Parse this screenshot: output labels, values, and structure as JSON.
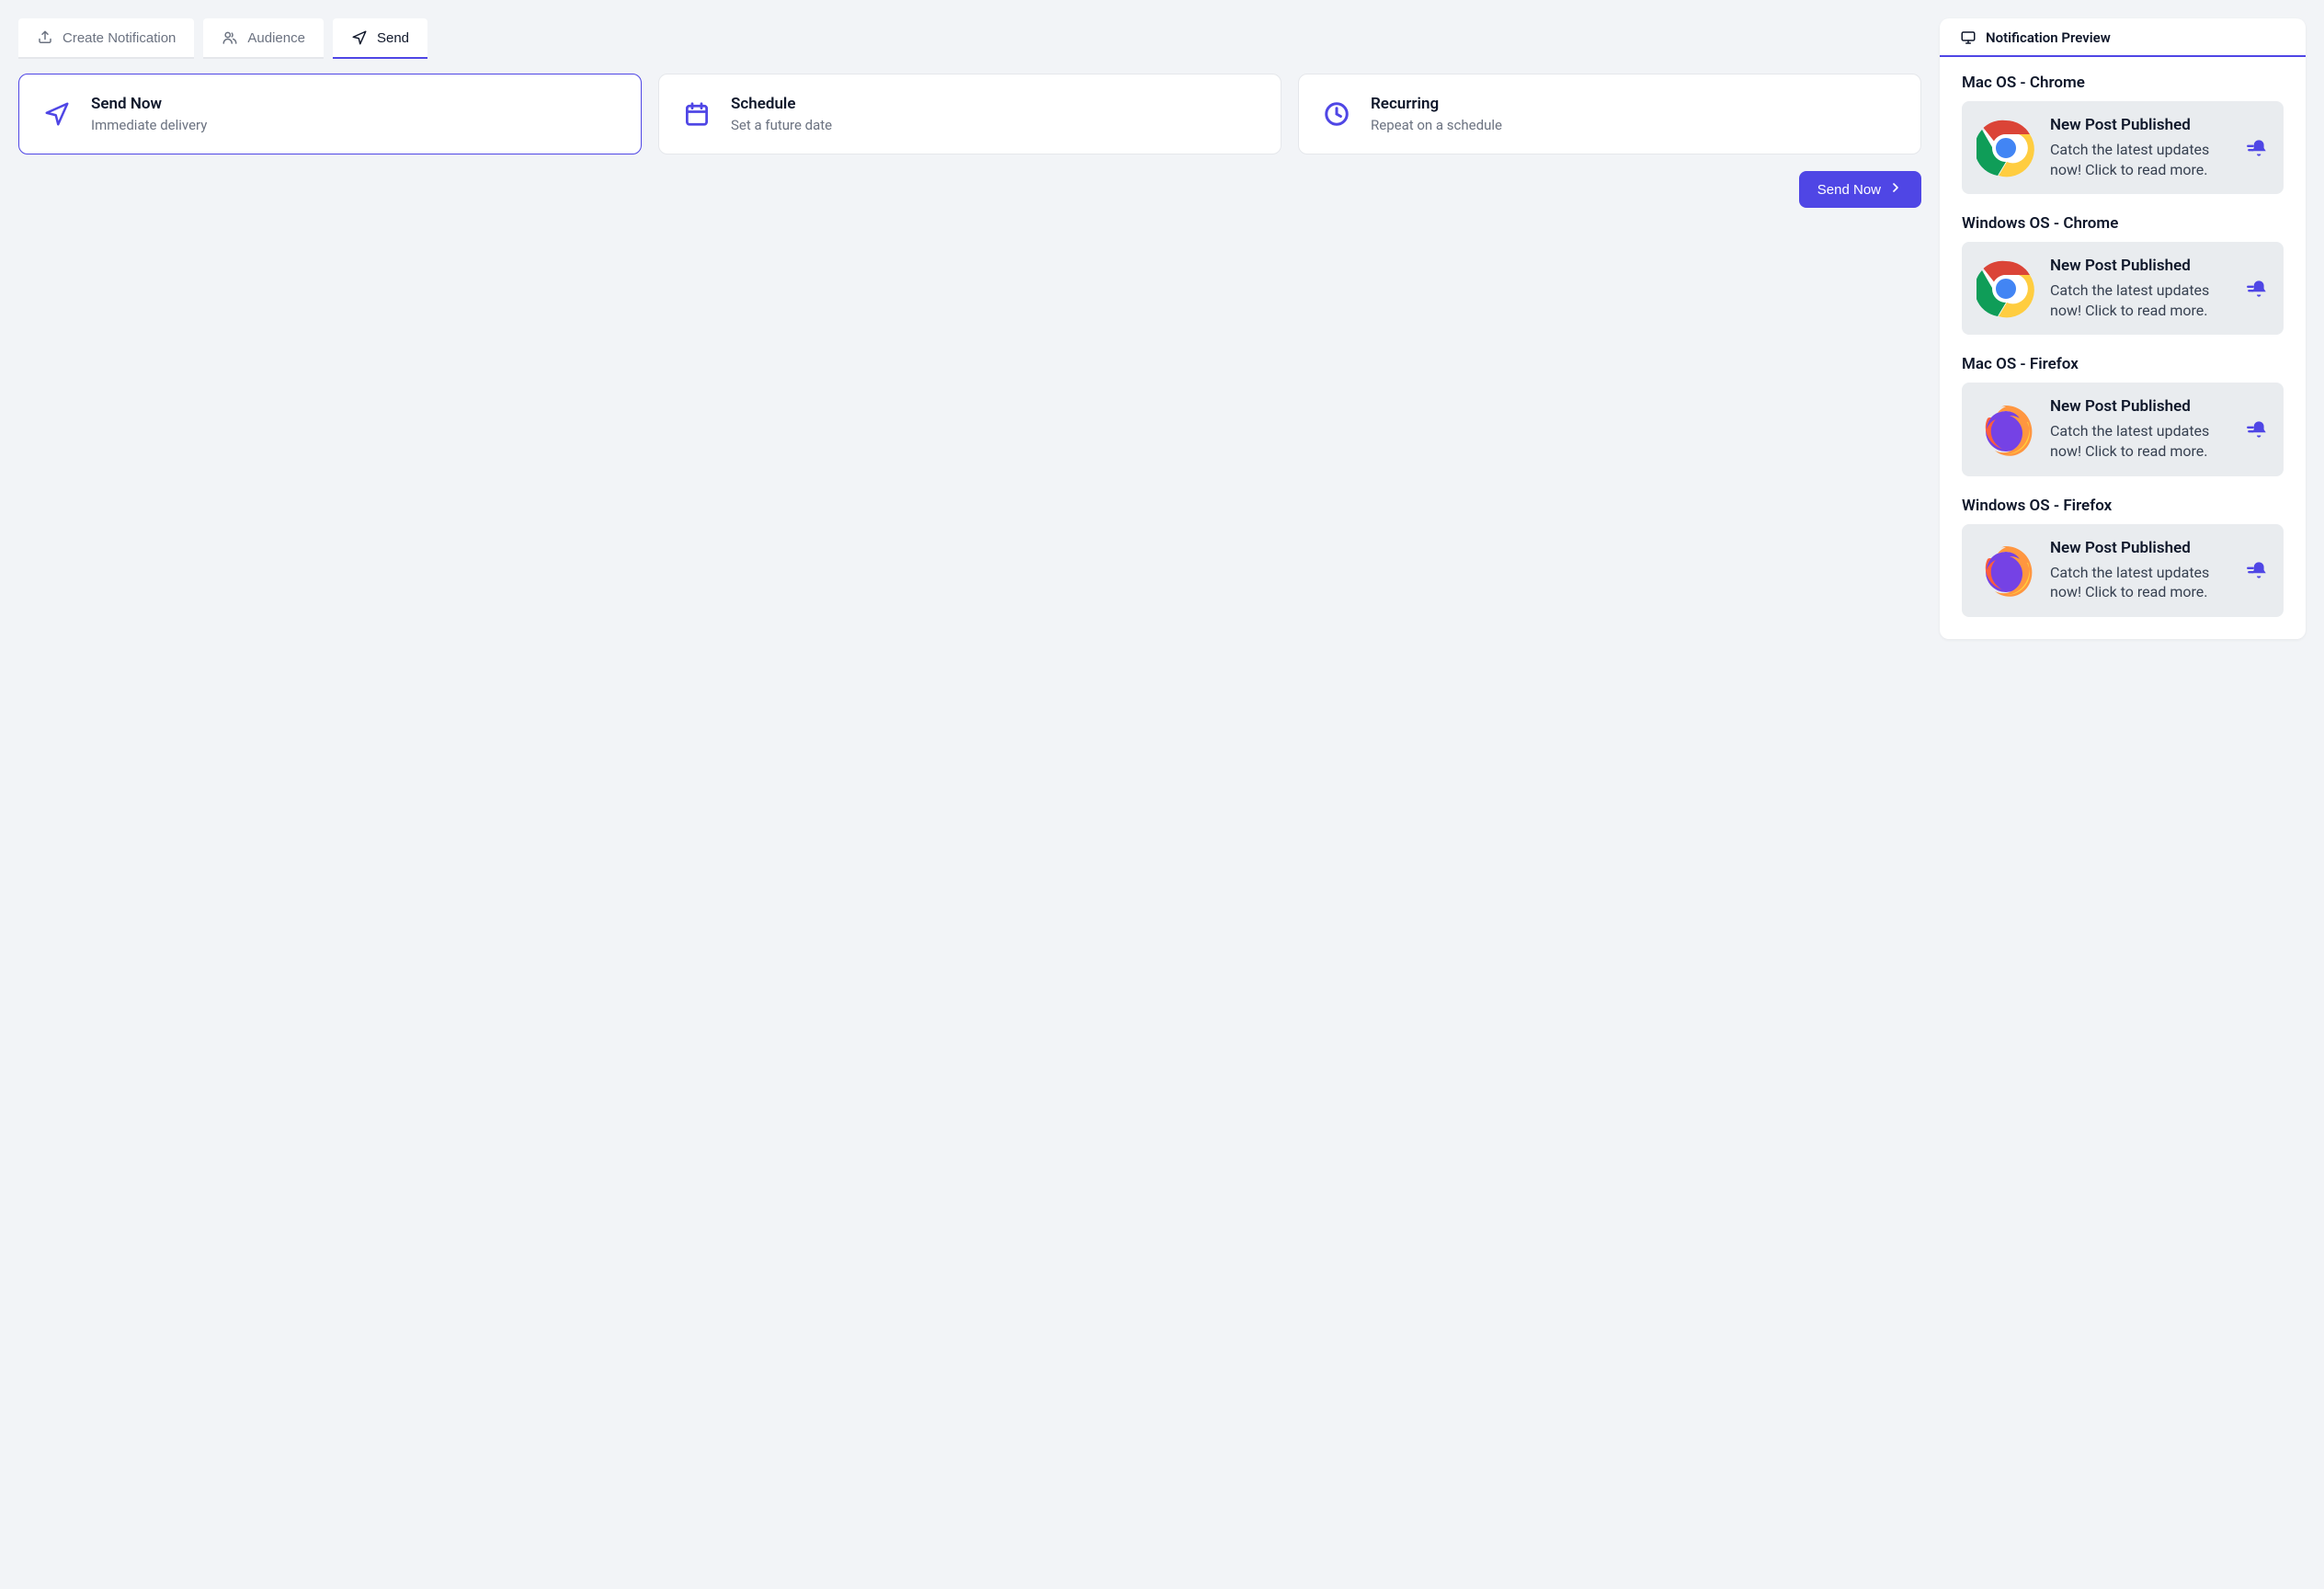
{
  "tabs": [
    {
      "label": "Create Notification",
      "icon": "upload"
    },
    {
      "label": "Audience",
      "icon": "users"
    },
    {
      "label": "Send",
      "icon": "send"
    }
  ],
  "active_tab_index": 2,
  "options": [
    {
      "title": "Send Now",
      "subtitle": "Immediate delivery",
      "icon": "send",
      "selected": true
    },
    {
      "title": "Schedule",
      "subtitle": "Set a future date",
      "icon": "calendar",
      "selected": false
    },
    {
      "title": "Recurring",
      "subtitle": "Repeat on a schedule",
      "icon": "clock",
      "selected": false
    }
  ],
  "primary_action": {
    "label": "Send Now"
  },
  "preview": {
    "title": "Notification Preview",
    "groups": [
      {
        "label": "Mac OS - Chrome",
        "browser": "chrome",
        "title": "New Post Published",
        "body": "Catch the latest updates now! Click to read more."
      },
      {
        "label": "Windows OS - Chrome",
        "browser": "chrome",
        "title": "New Post Published",
        "body": "Catch the latest updates now! Click to read more."
      },
      {
        "label": "Mac OS - Firefox",
        "browser": "firefox",
        "title": "New Post Published",
        "body": "Catch the latest updates now! Click to read more."
      },
      {
        "label": "Windows OS - Firefox",
        "browser": "firefox",
        "title": "New Post Published",
        "body": "Catch the latest updates now! Click to read more."
      }
    ]
  }
}
